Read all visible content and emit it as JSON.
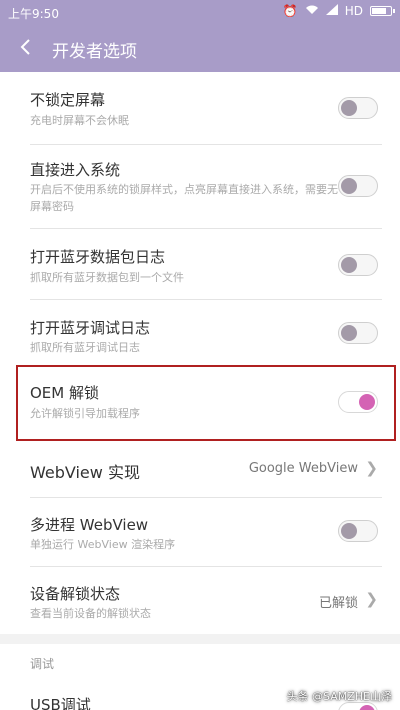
{
  "status_bar": {
    "time": "上午9:50",
    "network": "HD"
  },
  "app_bar": {
    "title": "开发者选项"
  },
  "items": [
    {
      "title": "不锁定屏幕",
      "subtitle": "充电时屏幕不会休眠",
      "toggle": "off"
    },
    {
      "title": "直接进入系统",
      "subtitle": "开启后不使用系统的锁屏样式，点亮屏幕直接进入系统，需要无屏幕密码",
      "toggle": "off"
    },
    {
      "title": "打开蓝牙数据包日志",
      "subtitle": "抓取所有蓝牙数据包到一个文件",
      "toggle": "off"
    },
    {
      "title": "打开蓝牙调试日志",
      "subtitle": "抓取所有蓝牙调试日志",
      "toggle": "off"
    },
    {
      "title": "OEM 解锁",
      "subtitle": "允许解锁引导加载程序",
      "toggle": "on"
    },
    {
      "title": "WebView 实现",
      "value": "Google WebView"
    },
    {
      "title": "多进程 WebView",
      "subtitle": "单独运行 WebView 渲染程序",
      "toggle": "off"
    },
    {
      "title": "设备解锁状态",
      "subtitle": "查看当前设备的解锁状态",
      "value": "已解锁"
    }
  ],
  "section": {
    "header": "调试"
  },
  "usb_item": {
    "title": "USB调试",
    "toggle": "on"
  },
  "watermark": "头条 @SAMZHE山泽",
  "colors": {
    "header": "#a89cc8",
    "accent": "#d463b4",
    "highlight_border": "#b02020"
  },
  "icons": [
    "back-arrow-icon",
    "alarm-icon",
    "wifi-icon",
    "signal-icon",
    "battery-icon",
    "chevron-right-icon"
  ]
}
